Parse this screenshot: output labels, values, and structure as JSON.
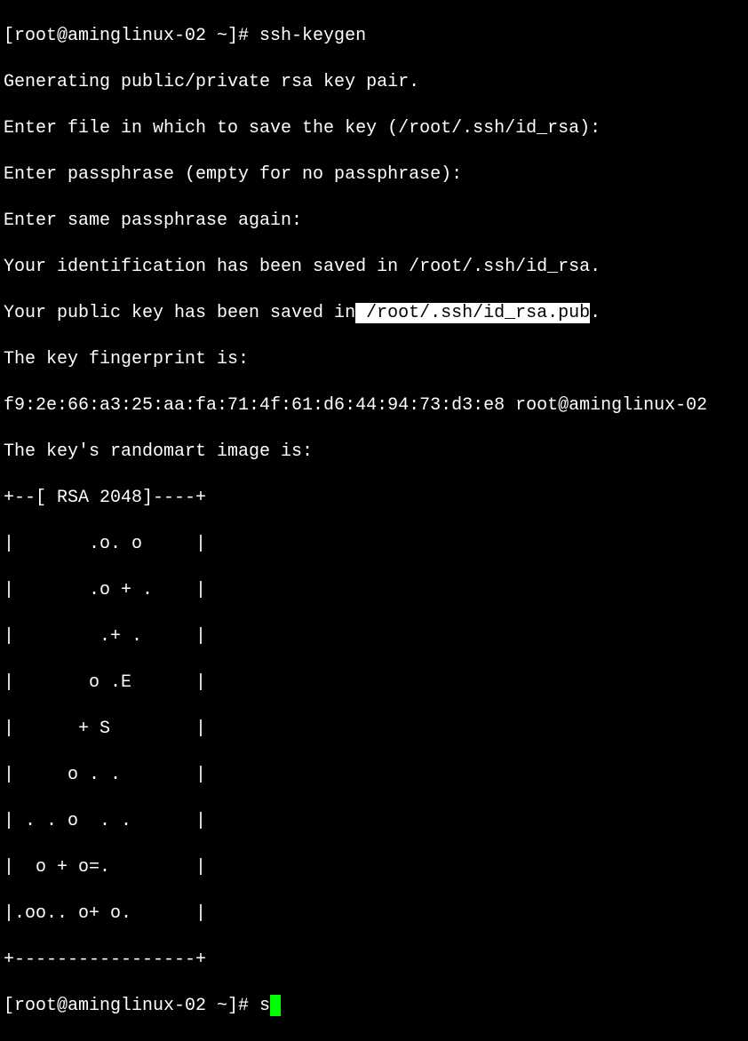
{
  "terminal": {
    "line0_prompt": "[root@aminglinux-02 ~]# ",
    "line0_cmd": "ssh-keygen",
    "line1": "Generating public/private rsa key pair.",
    "line2": "Enter file in which to save the key (/root/.ssh/id_rsa):",
    "line3": "Enter passphrase (empty for no passphrase):",
    "line4": "Enter same passphrase again:",
    "line5": "Your identification has been saved in /root/.ssh/id_rsa.",
    "line6_pre": "Your public key has been saved in",
    "line6_hl": " /root/.ssh/id_rsa.pub",
    "line6_post": ".",
    "line7": "The key fingerprint is:",
    "line8": "f9:2e:66:a3:25:aa:fa:71:4f:61:d6:44:94:73:d3:e8 root@aminglinux-02",
    "line9": "The key's randomart image is:",
    "ra0": "+--[ RSA 2048]----+",
    "ra1": "|       .o. o     |",
    "ra2": "|       .o + .    |",
    "ra3": "|        .+ .     |",
    "ra4": "|       o .E      |",
    "ra5": "|      + S        |",
    "ra6": "|     o . .       |",
    "ra7": "| . . o  . .      |",
    "ra8": "|  o + o=.        |",
    "ra9": "|.oo.. o+ o.      |",
    "ra10": "+-----------------+",
    "prompt2": "[root@aminglinux-02 ~]# ",
    "typed": "s"
  }
}
